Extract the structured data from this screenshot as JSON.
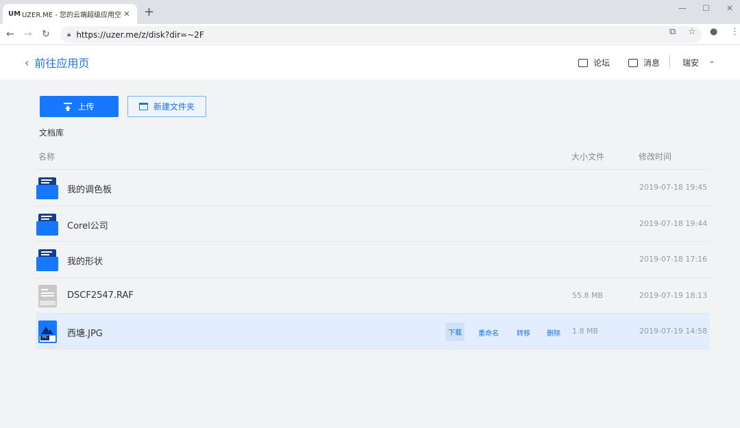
{
  "browser": {
    "tab_title": "UZER.ME - 您的云端超级应用空间",
    "favicon": "UM",
    "tab_close": "✕",
    "new_tab": "+",
    "url": "https://uzer.me/z/disk?dir=~2F",
    "minimize": "—",
    "maximize": "☐",
    "close": "✕"
  },
  "header": {
    "back_label": "前往应用页",
    "forum_label": "论坛",
    "messages_label": "消息",
    "user_name": "瑞安"
  },
  "toolbar": {
    "upload_label": "上传",
    "new_folder_label": "新建文件夹"
  },
  "library": {
    "title": "文档库",
    "columns": {
      "name": "名称",
      "size": "大小文件",
      "modified": "修改时间"
    },
    "rows": [
      {
        "type": "folder",
        "name": "我的调色板",
        "size": "",
        "modified": "2019-07-18 19:45"
      },
      {
        "type": "folder",
        "name": "Corel公司",
        "size": "",
        "modified": "2019-07-18 19:44"
      },
      {
        "type": "folder",
        "name": "我的形状",
        "size": "",
        "modified": "2019-07-18 17:16"
      },
      {
        "type": "file",
        "name": "DSCF2547.RAF",
        "size": "55.8 MB",
        "modified": "2019-07-19 18:13"
      },
      {
        "type": "image",
        "name": "西塘.JPG",
        "size": "1.8 MB",
        "modified": "2019-07-19 14:58"
      }
    ],
    "row_actions": {
      "download": "下载",
      "rename": "重命名",
      "move": "转移",
      "delete": "删除"
    }
  },
  "colors": {
    "accent": "#1677ff",
    "folder_back": "#123e8c",
    "highlight_row": "#e2eefe"
  }
}
